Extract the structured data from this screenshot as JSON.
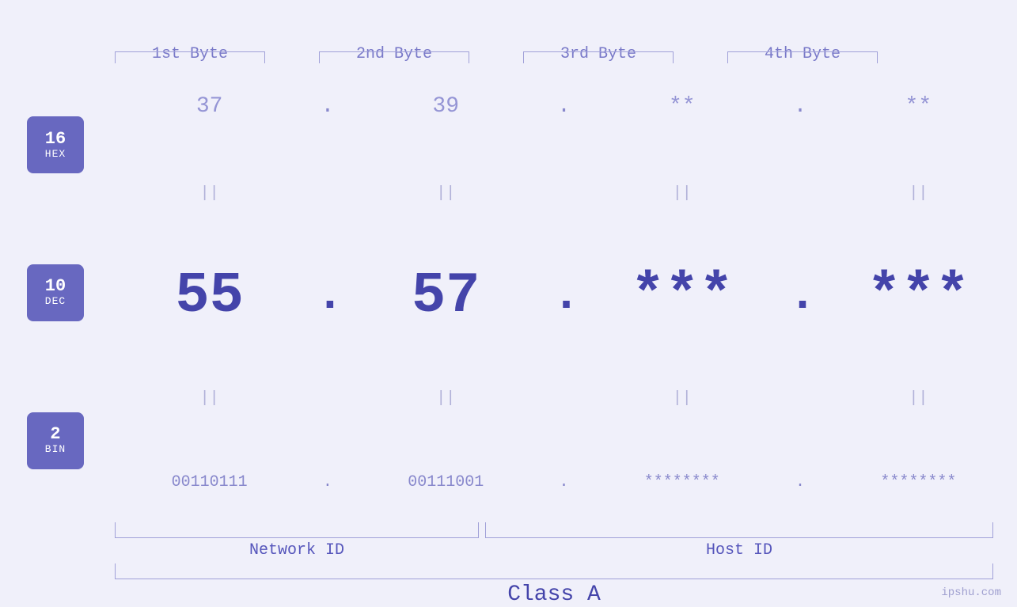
{
  "headers": {
    "byte1": "1st Byte",
    "byte2": "2nd Byte",
    "byte3": "3rd Byte",
    "byte4": "4th Byte"
  },
  "badges": {
    "hex": {
      "number": "16",
      "label": "HEX"
    },
    "dec": {
      "number": "10",
      "label": "DEC"
    },
    "bin": {
      "number": "2",
      "label": "BIN"
    }
  },
  "values": {
    "hex": {
      "b1": "37",
      "b2": "39",
      "b3": "**",
      "b4": "**",
      "d1": ".",
      "d2": ".",
      "d3": ".",
      "d4": "."
    },
    "dec": {
      "b1": "55",
      "b2": "57",
      "b3": "***",
      "b4": "***",
      "d1": ".",
      "d2": ".",
      "d3": ".",
      "d4": "."
    },
    "bin": {
      "b1": "00110111",
      "b2": "00111001",
      "b3": "********",
      "b4": "********",
      "d1": ".",
      "d2": ".",
      "d3": ".",
      "d4": "."
    }
  },
  "labels": {
    "network_id": "Network ID",
    "host_id": "Host ID",
    "class": "Class A"
  },
  "separators": {
    "sym": "||"
  },
  "watermark": "ipshu.com"
}
